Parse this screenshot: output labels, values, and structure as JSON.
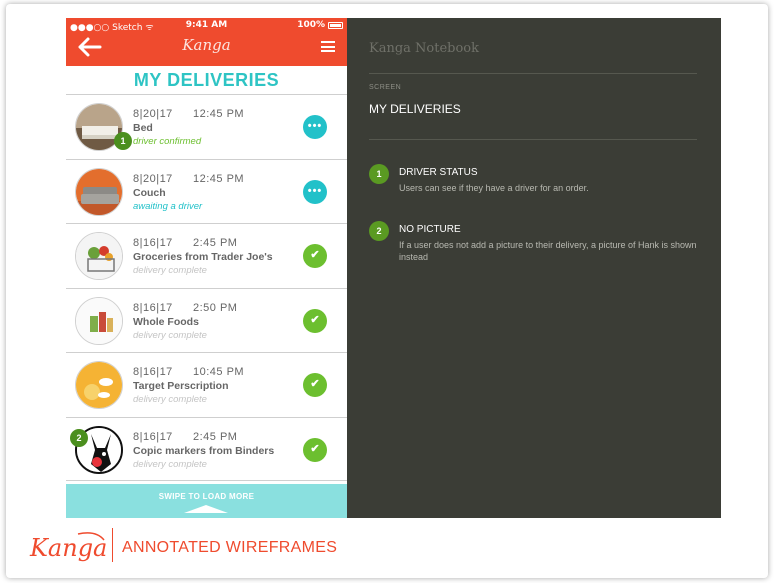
{
  "status_bar": {
    "carrier": "Sketch",
    "time": "9:41 AM",
    "battery": "100%"
  },
  "header": {
    "logo_text": "Kanga"
  },
  "page_title": "MY DELIVERIES",
  "deliveries": [
    {
      "date": "8|20|17",
      "time": "12:45 PM",
      "name": "Bed",
      "status": "driver confirmed",
      "status_color": "#6cbf2f",
      "action": "more",
      "image": "bed"
    },
    {
      "date": "8|20|17",
      "time": "12:45 PM",
      "name": "Couch",
      "status": "awaiting a driver",
      "status_color": "#22c1c9",
      "action": "more",
      "image": "couch"
    },
    {
      "date": "8|16|17",
      "time": "2:45 PM",
      "name": "Groceries from Trader Joe's",
      "status": "delivery complete",
      "status_color": "#c4c4c4",
      "action": "check",
      "image": "groceries"
    },
    {
      "date": "8|16|17",
      "time": "2:50 PM",
      "name": "Whole Foods",
      "status": "delivery complete",
      "status_color": "#c4c4c4",
      "action": "check",
      "image": "whole-foods"
    },
    {
      "date": "8|16|17",
      "time": "10:45 PM",
      "name": "Target Perscription",
      "status": "delivery complete",
      "status_color": "#c4c4c4",
      "action": "check",
      "image": "pills"
    },
    {
      "date": "8|16|17",
      "time": "2:45 PM",
      "name": "Copic markers from Binders",
      "status": "delivery complete",
      "status_color": "#c4c4c4",
      "action": "check",
      "image": "hank"
    }
  ],
  "badges": {
    "driver_status": "1",
    "no_picture": "2"
  },
  "load_more_label": "SWIPE TO LOAD MORE",
  "notebook": {
    "title": "Kanga Notebook",
    "screen_label": "SCREEN",
    "screen_name": "MY DELIVERIES",
    "notes": [
      {
        "num": "1",
        "title": "DRIVER STATUS",
        "desc": "Users can see if they have a driver for an order."
      },
      {
        "num": "2",
        "title": "NO PICTURE",
        "desc": "If a user does not add a picture to their delivery, a picture of Hank is shown instead"
      }
    ]
  },
  "footer": {
    "logo_text": "Kanga",
    "title": "ANNOTATED WIREFRAMES"
  },
  "colors": {
    "brand": "#ef4b2e",
    "teal": "#22c1c9",
    "green": "#6cbf2f",
    "notebook_bg": "#3b3d36"
  }
}
